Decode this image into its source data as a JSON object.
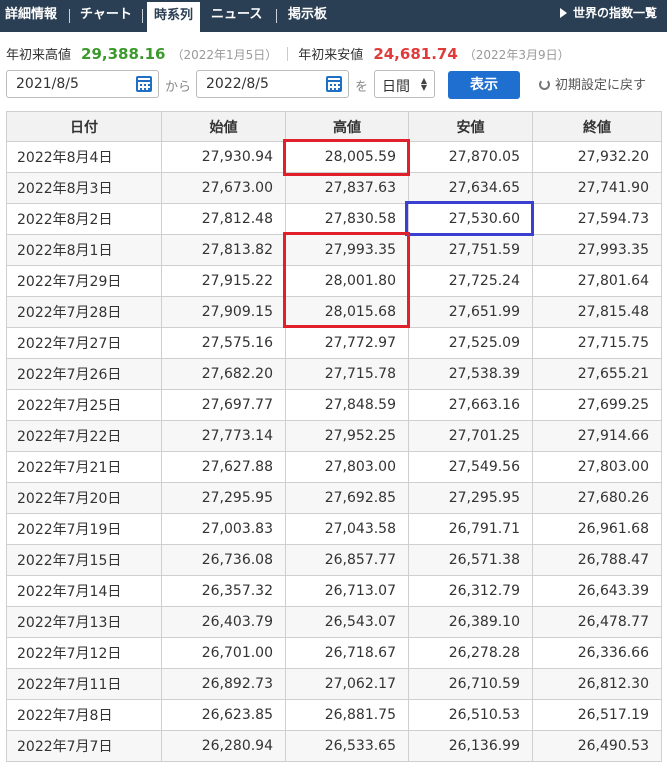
{
  "nav": {
    "tabs": [
      {
        "label": "詳細情報"
      },
      {
        "label": "チャート"
      },
      {
        "label": "時系列"
      },
      {
        "label": "ニュース"
      },
      {
        "label": "掲示板"
      }
    ],
    "world_link": "世界の指数一覧"
  },
  "yearly": {
    "high_label": "年初来高値",
    "high_value": "29,388.16",
    "high_date": "（2022年1月5日）",
    "low_label": "年初来安値",
    "low_value": "24,681.74",
    "low_date": "（2022年3月9日）"
  },
  "controls": {
    "from_date": "2021/8/5",
    "from_text": "から",
    "to_date": "2022/8/5",
    "to_text": "を",
    "interval": "日間",
    "show_button": "表示",
    "reset": "初期設定に戻す"
  },
  "table": {
    "headers": [
      "日付",
      "始値",
      "高値",
      "安値",
      "終値"
    ],
    "rows": [
      [
        "2022年8月4日",
        "27,930.94",
        "28,005.59",
        "27,870.05",
        "27,932.20"
      ],
      [
        "2022年8月3日",
        "27,673.00",
        "27,837.63",
        "27,634.65",
        "27,741.90"
      ],
      [
        "2022年8月2日",
        "27,812.48",
        "27,830.58",
        "27,530.60",
        "27,594.73"
      ],
      [
        "2022年8月1日",
        "27,813.82",
        "27,993.35",
        "27,751.59",
        "27,993.35"
      ],
      [
        "2022年7月29日",
        "27,915.22",
        "28,001.80",
        "27,725.24",
        "27,801.64"
      ],
      [
        "2022年7月28日",
        "27,909.15",
        "28,015.68",
        "27,651.99",
        "27,815.48"
      ],
      [
        "2022年7月27日",
        "27,575.16",
        "27,772.97",
        "27,525.09",
        "27,715.75"
      ],
      [
        "2022年7月26日",
        "27,682.20",
        "27,715.78",
        "27,538.39",
        "27,655.21"
      ],
      [
        "2022年7月25日",
        "27,697.77",
        "27,848.59",
        "27,663.16",
        "27,699.25"
      ],
      [
        "2022年7月22日",
        "27,773.14",
        "27,952.25",
        "27,701.25",
        "27,914.66"
      ],
      [
        "2022年7月21日",
        "27,627.88",
        "27,803.00",
        "27,549.56",
        "27,803.00"
      ],
      [
        "2022年7月20日",
        "27,295.95",
        "27,692.85",
        "27,295.95",
        "27,680.26"
      ],
      [
        "2022年7月19日",
        "27,003.83",
        "27,043.58",
        "26,791.71",
        "26,961.68"
      ],
      [
        "2022年7月15日",
        "26,736.08",
        "26,857.77",
        "26,571.38",
        "26,788.47"
      ],
      [
        "2022年7月14日",
        "26,357.32",
        "26,713.07",
        "26,312.79",
        "26,643.39"
      ],
      [
        "2022年7月13日",
        "26,403.79",
        "26,543.07",
        "26,389.10",
        "26,478.77"
      ],
      [
        "2022年7月12日",
        "26,701.00",
        "26,718.67",
        "26,278.28",
        "26,336.66"
      ],
      [
        "2022年7月11日",
        "26,892.73",
        "27,062.17",
        "26,710.59",
        "26,812.30"
      ],
      [
        "2022年7月8日",
        "26,623.85",
        "26,881.75",
        "26,510.53",
        "26,517.19"
      ],
      [
        "2022年7月7日",
        "26,280.94",
        "26,533.65",
        "26,136.99",
        "26,490.53"
      ]
    ]
  },
  "colors": {
    "nav_bg": "#2b3f54",
    "high_green": "#3b9a2b",
    "low_red": "#e03b3b",
    "button_blue": "#1e6fd0",
    "highlight_red": "#e0202a",
    "highlight_blue": "#3a3fd0"
  }
}
